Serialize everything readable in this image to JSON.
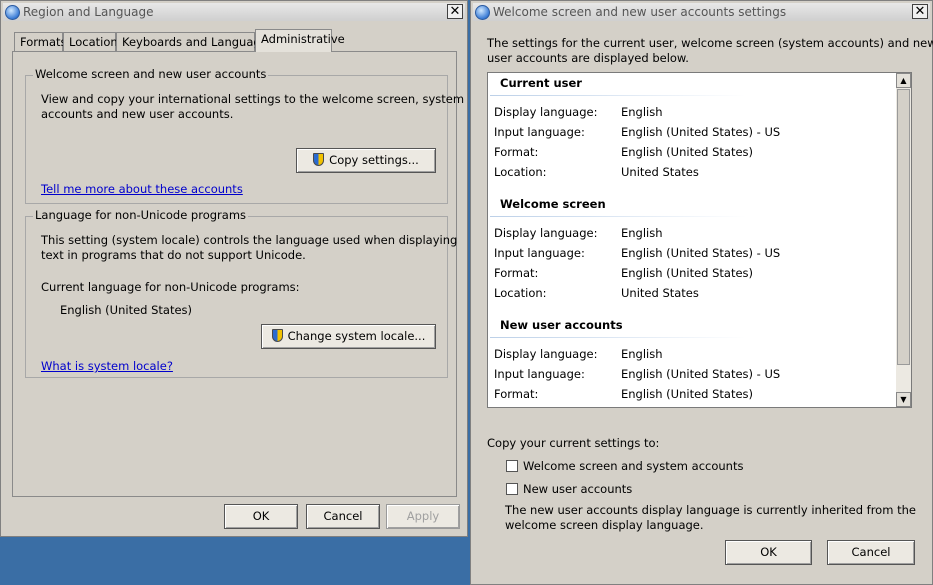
{
  "left_dialog": {
    "title": "Region and Language",
    "tabs": [
      "Formats",
      "Location",
      "Keyboards and Languages",
      "Administrative"
    ],
    "welcome_group": {
      "legend": "Welcome screen and new user accounts",
      "description_line1": "View and copy your international settings to the welcome screen, system",
      "description_line2": "accounts and new user accounts.",
      "copy_button": "Copy settings...",
      "link": "Tell me more about these accounts"
    },
    "nonunicode_group": {
      "legend": "Language for non-Unicode programs",
      "description_line1": "This setting (system locale) controls the language used when displaying",
      "description_line2": "text in programs that do not support Unicode.",
      "current_label": "Current language for non-Unicode programs:",
      "current_value": "English (United States)",
      "change_button": "Change system locale...",
      "link": "What is system locale?"
    },
    "buttons": {
      "ok": "OK",
      "cancel": "Cancel",
      "apply": "Apply"
    }
  },
  "right_dialog": {
    "title": "Welcome screen and new user accounts settings",
    "intro_line1": "The settings for the current user, welcome screen (system accounts) and new",
    "intro_line2": "user accounts are displayed below.",
    "sections": [
      {
        "heading": "Current user",
        "rows": [
          {
            "label": "Display language:",
            "value": "English"
          },
          {
            "label": "Input language:",
            "value": "English (United States) - US"
          },
          {
            "label": "Format:",
            "value": "English (United States)"
          },
          {
            "label": "Location:",
            "value": "United States"
          }
        ]
      },
      {
        "heading": "Welcome screen",
        "rows": [
          {
            "label": "Display language:",
            "value": "English"
          },
          {
            "label": "Input language:",
            "value": "English (United States) - US"
          },
          {
            "label": "Format:",
            "value": "English (United States)"
          },
          {
            "label": "Location:",
            "value": "United States"
          }
        ]
      },
      {
        "heading": "New user accounts",
        "rows": [
          {
            "label": "Display language:",
            "value": "English"
          },
          {
            "label": "Input language:",
            "value": "English (United States) - US"
          },
          {
            "label": "Format:",
            "value": "English (United States)"
          }
        ]
      }
    ],
    "copy_label": "Copy your current settings to:",
    "checkbox_welcome": {
      "label": "Welcome screen and system accounts",
      "checked": false
    },
    "checkbox_newuser": {
      "label": "New user accounts",
      "checked": false
    },
    "note_line1": "The new user accounts display language is currently inherited from the",
    "note_line2": "welcome screen display language.",
    "buttons": {
      "ok": "OK",
      "cancel": "Cancel"
    }
  }
}
